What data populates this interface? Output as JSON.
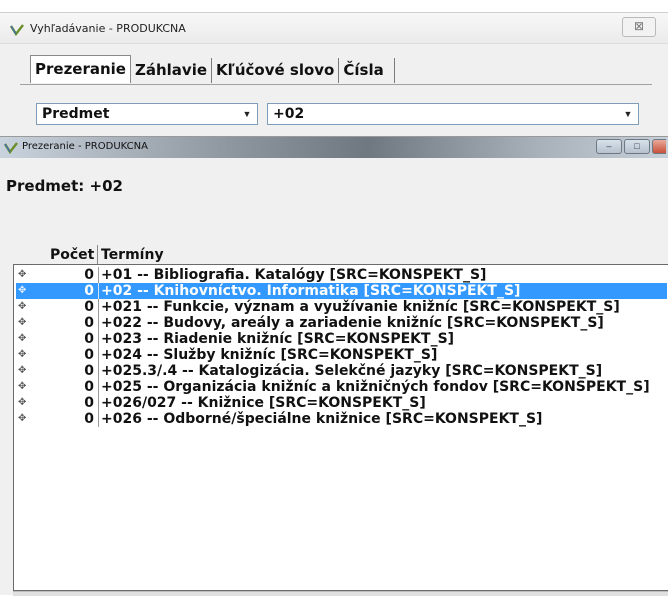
{
  "search_window": {
    "title": "Vyhľadávanie - PRODUKCNA",
    "close_glyph": "⊠",
    "tabs": [
      {
        "label": "Prezeranie",
        "active": true
      },
      {
        "label": "Záhlavie",
        "active": false
      },
      {
        "label": "Kľúčové slovo",
        "active": false
      },
      {
        "label": "Čísla",
        "active": false
      }
    ],
    "field_select": {
      "value": "Predmet"
    },
    "query_input": {
      "value": "+02"
    }
  },
  "browse_window": {
    "title": "Prezeranie - PRODUKCNA",
    "heading": "Predmet: +02",
    "columns": {
      "count": "Počet",
      "terms": "Termíny"
    },
    "selected_index": 1,
    "rows": [
      {
        "count": "0",
        "term": "+01 -- Bibliografia. Katalógy  [SRC=KONSPEKT_S]"
      },
      {
        "count": "0",
        "term": "+02 -- Knihovníctvo. Informatika  [SRC=KONSPEKT_S]"
      },
      {
        "count": "0",
        "term": "+021 -- Funkcie, význam a využívanie knižníc  [SRC=KONSPEKT_S]"
      },
      {
        "count": "0",
        "term": "+022 -- Budovy, areály a zariadenie knižníc  [SRC=KONSPEKT_S]"
      },
      {
        "count": "0",
        "term": "+023 -- Riadenie knižníc  [SRC=KONSPEKT_S]"
      },
      {
        "count": "0",
        "term": "+024 -- Služby knižníc  [SRC=KONSPEKT_S]"
      },
      {
        "count": "0",
        "term": "+025.3/.4 -- Katalogizácia. Selekčné jazyky  [SRC=KONSPEKT_S]"
      },
      {
        "count": "0",
        "term": "+025 -- Organizácia knižníc a knižničných fondov  [SRC=KONSPEKT_S]"
      },
      {
        "count": "0",
        "term": "+026/027 -- Knižnice  [SRC=KONSPEKT_S]"
      },
      {
        "count": "0",
        "term": "+026 -- Odborné/špeciálne knižnice  [SRC=KONSPEKT_S]"
      }
    ]
  },
  "colors": {
    "selection": "#3399ff",
    "window_bg": "#f0f0f0",
    "list_bg": "#ffffff"
  },
  "icons": {
    "app": "checkmark-logo-icon",
    "row_expander": "plus-expander-icon",
    "dropdown": "triangle-down-icon"
  }
}
